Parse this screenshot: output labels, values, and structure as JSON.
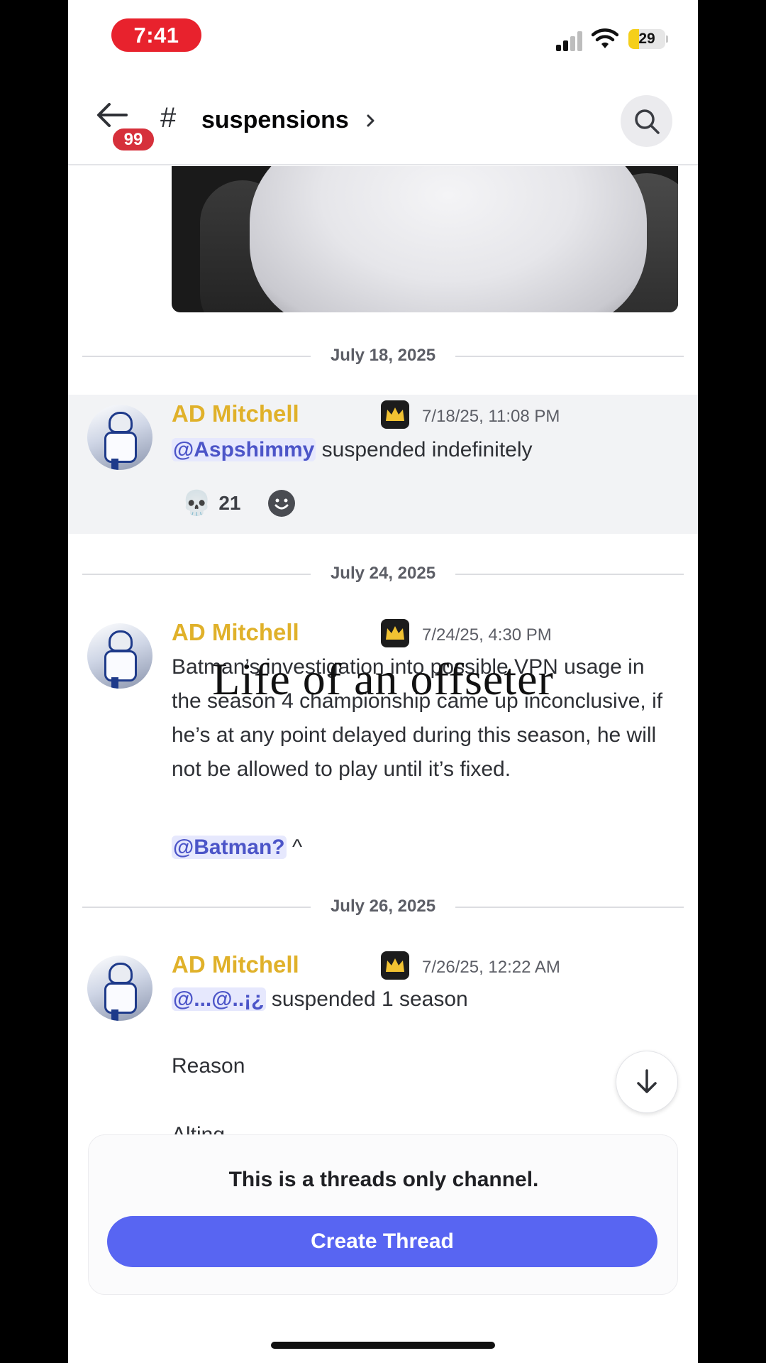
{
  "status_bar": {
    "time": "7:41",
    "battery_level": "29",
    "battery_fraction": 0.29,
    "icons": [
      "signal-icon",
      "wifi-icon",
      "battery-icon"
    ]
  },
  "header": {
    "unread_count": "99",
    "channel_prefix": "#",
    "channel_name": "suspensions",
    "icons": [
      "back-arrow-icon",
      "chevron-right-icon",
      "search-icon"
    ]
  },
  "dates": {
    "d1": "July 18, 2025",
    "d2": "July 24, 2025",
    "d3": "July 26, 2025"
  },
  "messages": [
    {
      "author": "AD Mitchell",
      "timestamp": "7/18/25, 11:08 PM",
      "mention": "@Aspshimmy",
      "text": " suspended indefinitely",
      "reaction_emoji": "💀",
      "reaction_count": "21"
    },
    {
      "author": "AD Mitchell",
      "timestamp": "7/24/25, 4:30 PM",
      "text": "Batman’s investigation into possible VPN usage in the season 4 championship came up inconclusive, if he’s at any point delayed during this season, he will not be allowed to play until it’s fixed.",
      "mention": "@Batman?",
      "suffix": " ^"
    },
    {
      "author": "AD Mitchell",
      "timestamp": "7/26/25, 12:22 AM",
      "mention": "@...@..¡¿",
      "text": " suspended 1 season",
      "reason_label": "Reason",
      "partial_text": "Alting"
    }
  ],
  "overlay_caption": "Life of an offseter",
  "threads": {
    "notice": "This is a threads only channel.",
    "button_label": "Create Thread"
  },
  "colors": {
    "author": "#e0b12a",
    "mention_bg": "#e6e8fd",
    "mention_text": "#4c55c8",
    "accent": "#5865f2",
    "badge_red": "#d6303b",
    "time_pill": "#e8222d"
  }
}
